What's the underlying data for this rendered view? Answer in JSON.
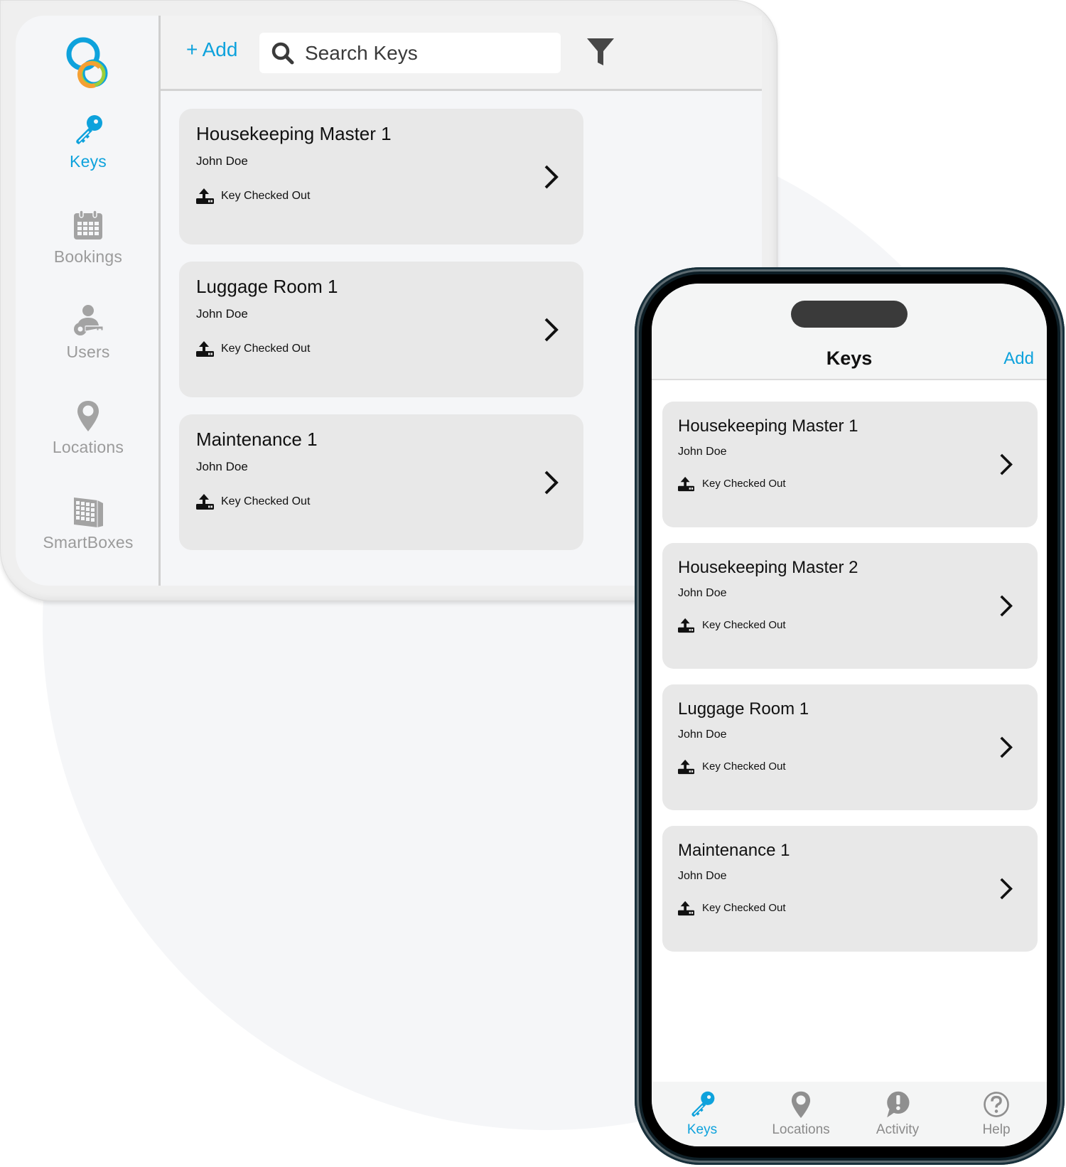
{
  "colors": {
    "accent": "#0ea2dc",
    "inactive": "#9b9b9b",
    "card_bg": "#e8e8e8",
    "logo_blue": "#0ea2dc",
    "logo_orange": "#f5a033",
    "logo_green": "#9ccf3a"
  },
  "tablet": {
    "sidebar": {
      "logo": "logo-rings-icon",
      "items": [
        {
          "label": "Keys",
          "icon": "key-icon",
          "active": true
        },
        {
          "label": "Bookings",
          "icon": "calendar-icon",
          "active": false
        },
        {
          "label": "Users",
          "icon": "user-key-icon",
          "active": false
        },
        {
          "label": "Locations",
          "icon": "location-pin-icon",
          "active": false
        },
        {
          "label": "SmartBoxes",
          "icon": "smartbox-icon",
          "active": false
        }
      ]
    },
    "toolbar": {
      "add_label": "+ Add",
      "search_placeholder": "Search Keys",
      "search_value": "",
      "filter_icon": "filter-icon"
    },
    "keys": [
      {
        "title": "Housekeeping Master 1",
        "owner": "John Doe",
        "status": "Key Checked Out"
      },
      {
        "title": "Luggage Room 1",
        "owner": "John Doe",
        "status": "Key Checked Out"
      },
      {
        "title": "Maintenance 1",
        "owner": "John Doe",
        "status": "Key Checked Out"
      }
    ]
  },
  "phone": {
    "header": {
      "title": "Keys",
      "add_label": "Add"
    },
    "keys": [
      {
        "title": "Housekeeping Master 1",
        "owner": "John Doe",
        "status": "Key Checked Out"
      },
      {
        "title": "Housekeeping Master 2",
        "owner": "John Doe",
        "status": "Key Checked Out"
      },
      {
        "title": "Luggage Room 1",
        "owner": "John Doe",
        "status": "Key Checked Out"
      },
      {
        "title": "Maintenance 1",
        "owner": "John Doe",
        "status": "Key Checked Out"
      }
    ],
    "tabs": [
      {
        "label": "Keys",
        "icon": "key-icon",
        "active": true
      },
      {
        "label": "Locations",
        "icon": "location-pin-icon",
        "active": false
      },
      {
        "label": "Activity",
        "icon": "activity-alert-icon",
        "active": false
      },
      {
        "label": "Help",
        "icon": "help-icon",
        "active": false
      }
    ]
  }
}
